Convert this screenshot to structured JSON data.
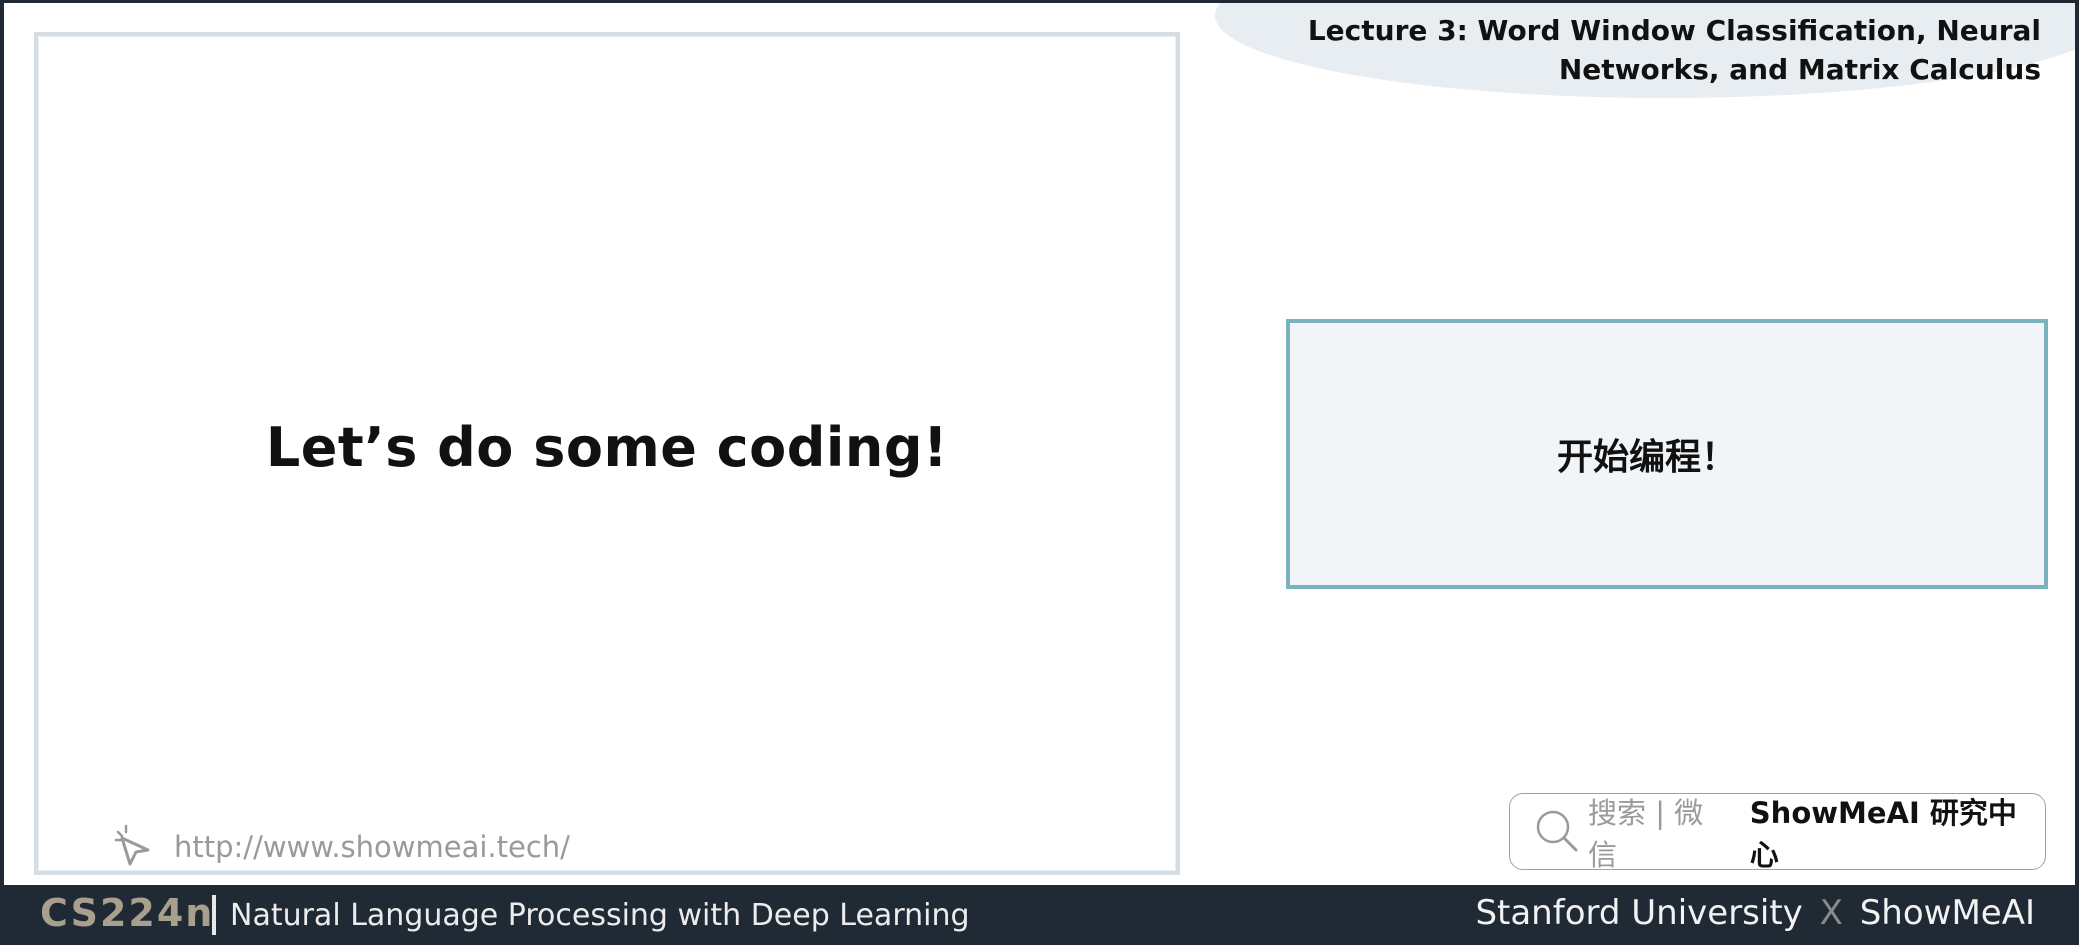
{
  "header": {
    "lecture_title_line1": "Lecture 3:  Word Window Classification, Neural",
    "lecture_title_line2": "Networks, and Matrix Calculus"
  },
  "slide": {
    "heading": "Let’s do some coding!",
    "watermark_url": "http://www.showmeai.tech/",
    "watermark_icon": "cursor-click-icon"
  },
  "translation": {
    "text": "开始编程！"
  },
  "search_badge": {
    "icon": "search-icon",
    "hint": "搜索 | 微信",
    "brand": "ShowMeAI 研究中心"
  },
  "footer": {
    "course_code": "CS224n",
    "course_name": "Natural Language Processing with Deep Learning",
    "credit_left": "Stanford University",
    "credit_sep": "X",
    "credit_right": "ShowMeAI"
  },
  "colors": {
    "footer_bg": "#1f2a35",
    "course_code": "#a89f8c",
    "translation_border": "#7ab3bd",
    "translation_bg": "#f2f5f8"
  }
}
